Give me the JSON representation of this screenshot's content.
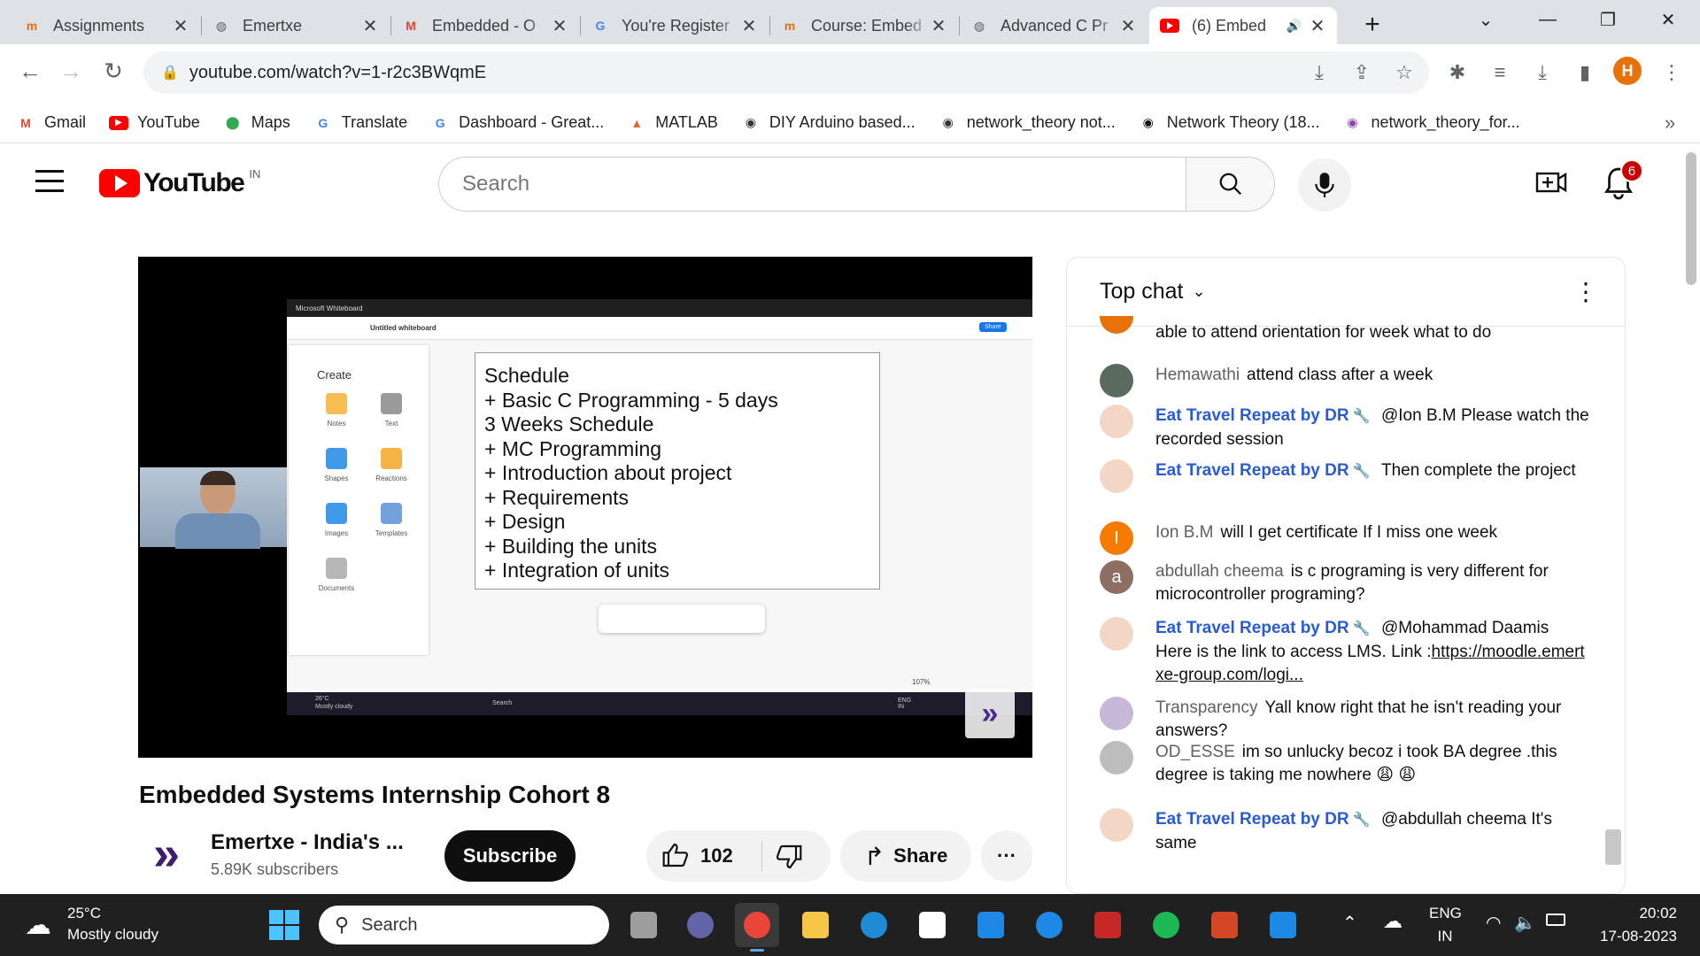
{
  "browser": {
    "tabs": [
      {
        "title": "Assignments",
        "icon": "emertxe-favicon",
        "color": "#e8710a"
      },
      {
        "title": "Emertxe",
        "icon": "globe-icon",
        "color": "#5f6368"
      },
      {
        "title": "Embedded - O",
        "icon": "gmail-icon",
        "color": "#ea4335"
      },
      {
        "title": "You're Register",
        "icon": "google-icon",
        "color": "#4285f4"
      },
      {
        "title": "Course: Embed",
        "icon": "emertxe-favicon",
        "color": "#e8710a"
      },
      {
        "title": "Advanced C Pr",
        "icon": "globe-icon",
        "color": "#5f6368"
      },
      {
        "title": "(6) Embed",
        "icon": "youtube-icon",
        "color": "#ff0000"
      }
    ],
    "new_tab": "+",
    "url": "youtube.com/watch?v=1-r2c3BWqmE",
    "profile_initial": "H",
    "bookmarks": [
      {
        "label": "Gmail",
        "icon": "gmail-icon",
        "color": "#ea4335"
      },
      {
        "label": "YouTube",
        "icon": "youtube-icon",
        "color": "#ff0000"
      },
      {
        "label": "Maps",
        "icon": "maps-icon",
        "color": "#34a853"
      },
      {
        "label": "Translate",
        "icon": "translate-icon",
        "color": "#4285f4"
      },
      {
        "label": "Dashboard - Great...",
        "icon": "google-icon",
        "color": "#4285f4"
      },
      {
        "label": "MATLAB",
        "icon": "matlab-icon",
        "color": "#e16737"
      },
      {
        "label": "DIY Arduino based...",
        "icon": "globe-icon",
        "color": "#333333"
      },
      {
        "label": "network_theory not...",
        "icon": "globe-icon",
        "color": "#333333"
      },
      {
        "label": "Network Theory (18...",
        "icon": "site-icon",
        "color": "#111111"
      },
      {
        "label": "network_theory_for...",
        "icon": "site-icon",
        "color": "#8e44ad"
      }
    ],
    "more_bookmarks": "»"
  },
  "youtube": {
    "logo_text": "YouTube",
    "region": "IN",
    "search_placeholder": "Search",
    "notification_count": "6",
    "video": {
      "whiteboard_app": "Microsoft Whiteboard",
      "whiteboard_name": "Untitled whiteboard",
      "share_label": "Share",
      "create_label": "Create",
      "tools": [
        "Notes",
        "Text",
        "Shapes",
        "Reactions",
        "Images",
        "Templates",
        "Documents"
      ],
      "schedule_lines": [
        "Schedule",
        "+ Basic C Programming - 5 days",
        "3 Weeks Schedule",
        "+ MC Programming",
        "+ Introduction about project",
        "+ Requirements",
        "+ Design",
        "+ Building the units",
        "+ Integration of units"
      ],
      "zoom": "107%",
      "inner_weather_temp": "26°C",
      "inner_weather_desc": "Mostly cloudy",
      "inner_search": "Search",
      "inner_lang": "ENG IN"
    },
    "title": "Embedded Systems Internship Cohort 8",
    "channel_name": "Emertxe - India's ...",
    "subscribers": "5.89K subscribers",
    "subscribe_label": "Subscribe",
    "likes": "102",
    "share_label": "Share",
    "more_label": "···",
    "chat": {
      "header": "Top chat",
      "messages": [
        {
          "author": "",
          "text": "able to attend orientation for week what to do",
          "avatar_color": "#e8710a",
          "initial": ""
        },
        {
          "author": "Hemawathi",
          "text": "attend class after a week",
          "avatar_color": "#5a6b5e",
          "initial": ""
        },
        {
          "author": "Eat Travel Repeat by DR",
          "text": "@Ion B.M Please watch the recorded session",
          "avatar_color": "#f4d6c4",
          "initial": "",
          "owner": true
        },
        {
          "author": "Eat Travel Repeat by DR",
          "text": "Then complete the project",
          "avatar_color": "#f4d6c4",
          "initial": "",
          "owner": true
        },
        {
          "author": "Ion B.M",
          "text": "will I get certificate If I miss one week",
          "avatar_color": "#f57c00",
          "initial": "I"
        },
        {
          "author": "abdullah cheema",
          "text": "is c programing is very different for microcontroller programing?",
          "avatar_color": "#8d6e63",
          "initial": "a"
        },
        {
          "author": "Eat Travel Repeat by DR",
          "text": "@Mohammad Daamis Here is the link to access LMS. Link :",
          "link": "https://moodle.emertxe-group.com/logi...",
          "avatar_color": "#f4d6c4",
          "initial": "",
          "owner": true
        },
        {
          "author": "Transparency",
          "text": "Yall know right that he isn't reading your answers?",
          "avatar_color": "#c8b8d8",
          "initial": ""
        },
        {
          "author": "OD_ESSE",
          "text": "im so unlucky becoz i took BA degree .this degree is taking me nowhere 😩 😩",
          "avatar_color": "#bdbdbd",
          "initial": ""
        },
        {
          "author": "Eat Travel Repeat by DR",
          "text": "@abdullah cheema It's same",
          "avatar_color": "#f4d6c4",
          "initial": "",
          "owner": true
        }
      ]
    }
  },
  "taskbar": {
    "weather_temp": "25°C",
    "weather_desc": "Mostly cloudy",
    "search_label": "Search",
    "lang_top": "ENG",
    "lang_bottom": "IN",
    "time": "20:02",
    "date": "17-08-2023"
  }
}
